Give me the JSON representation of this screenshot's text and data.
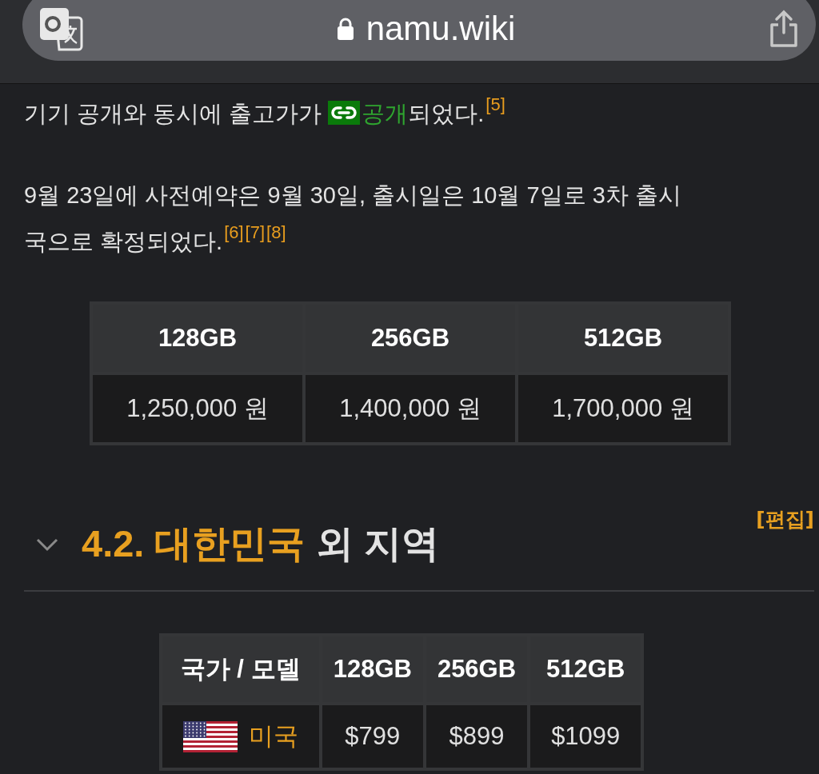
{
  "address_bar": {
    "url": "namu.wiki",
    "secure": true
  },
  "paragraphs": [
    {
      "segments": [
        {
          "kind": "text",
          "text": "기기 공개와 동시에 출고가가 "
        },
        {
          "kind": "link",
          "text": "공개"
        },
        {
          "kind": "text",
          "text": "되었다."
        },
        {
          "kind": "footnote",
          "text": "[5]"
        }
      ]
    },
    {
      "segments": [
        {
          "kind": "text",
          "text": "9월 23일에 사전예약은 9월 30일, 출시일은 10월 7일로 3차 출시",
          "break": true
        },
        {
          "kind": "text",
          "text": "국으로 확정되었다."
        },
        {
          "kind": "footnote",
          "text": "[6]"
        },
        {
          "kind": "footnote",
          "text": "[7]"
        },
        {
          "kind": "footnote",
          "text": "[8]"
        }
      ]
    }
  ],
  "price_table": {
    "columns": [
      "128GB",
      "256GB",
      "512GB"
    ],
    "rows": [
      [
        "1,250,000 원",
        "1,400,000 원",
        "1,700,000 원"
      ]
    ]
  },
  "section": {
    "number": "4.2.",
    "link": "대한민국",
    "rest": "외 지역",
    "expanded": true,
    "edit": "[편집]"
  },
  "region_table": {
    "columns": [
      "국가 / 모델",
      "128GB",
      "256GB",
      "512GB"
    ],
    "rows": [
      {
        "country": "미국",
        "prices": [
          "$799",
          "$899",
          "$1099"
        ]
      }
    ]
  }
}
